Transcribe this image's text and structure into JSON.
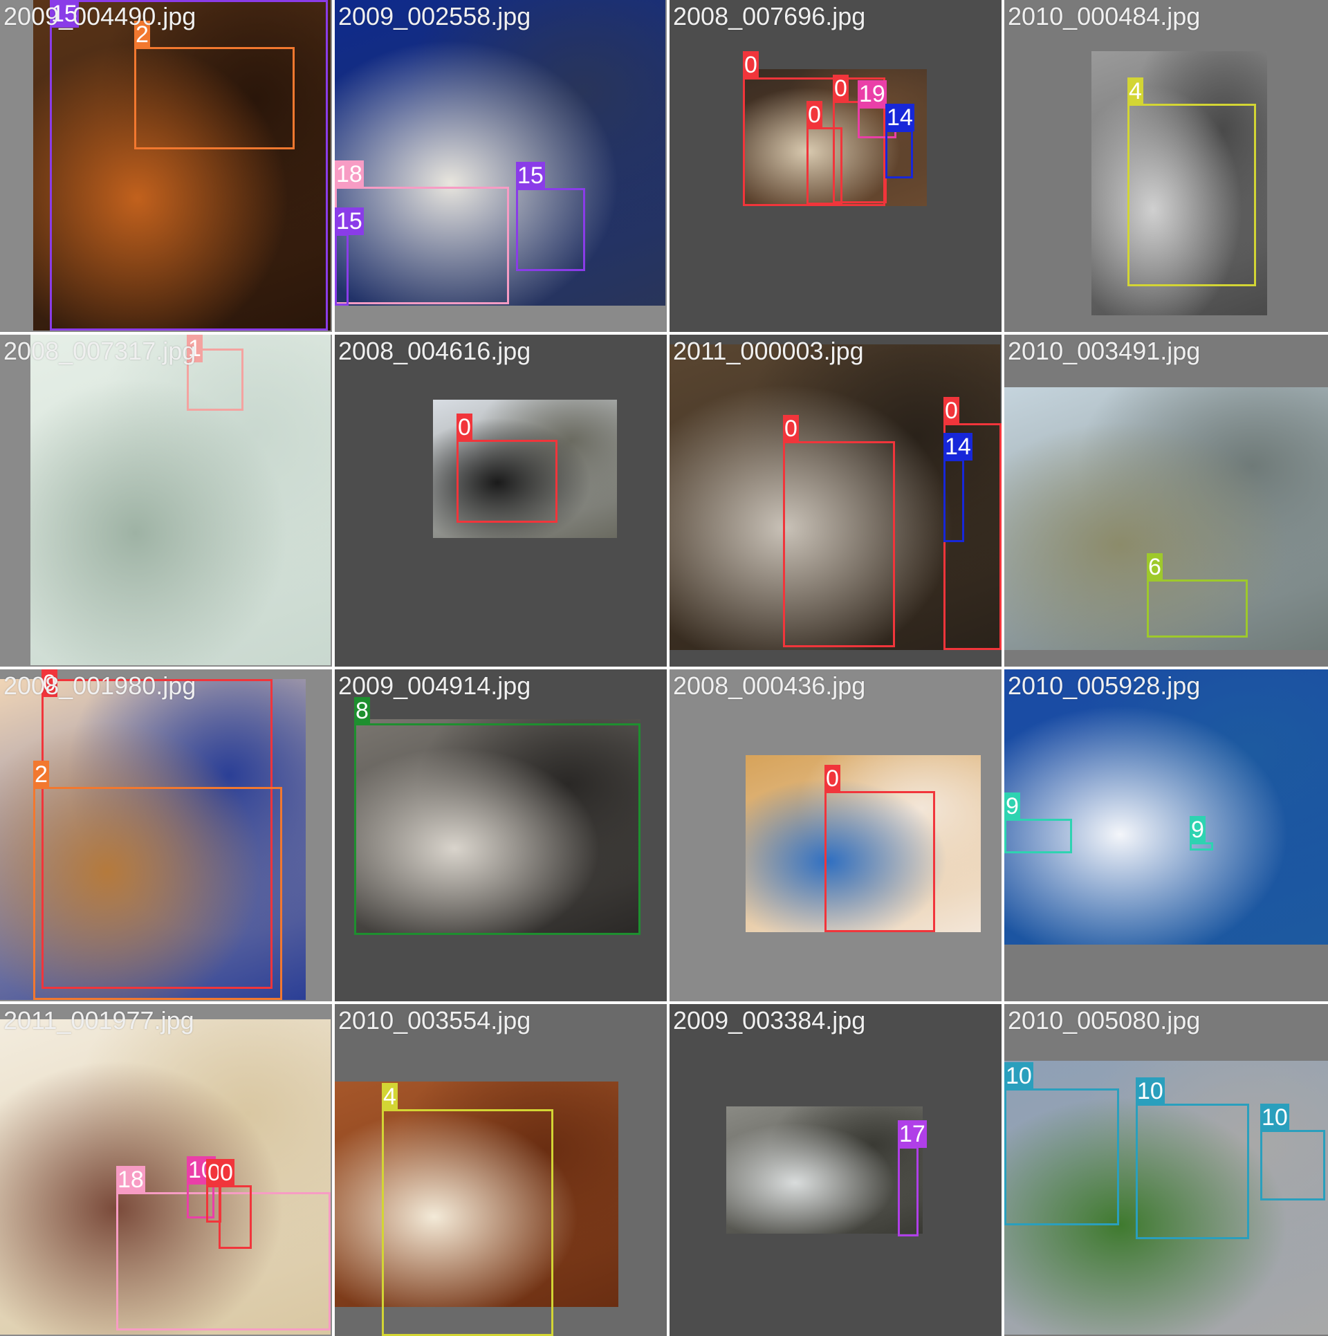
{
  "tiles": [
    {
      "filename": "2009_004490.jpg",
      "bg": "#8a8a8a",
      "photo_colors": [
        "#5a3418",
        "#c2611d",
        "#2a160a"
      ],
      "labels": [
        {
          "class": "15",
          "color": "#8a3ce8"
        },
        {
          "class": "2",
          "color": "#f2782f"
        }
      ]
    },
    {
      "filename": "2009_002558.jpg",
      "bg": "#8a8a8a",
      "photo_colors": [
        "#0e2a8c",
        "#e9e6de",
        "#29355a"
      ],
      "labels": [
        {
          "class": "18",
          "color": "#f79cc4"
        },
        {
          "class": "15",
          "color": "#8a3ce8"
        },
        {
          "class": "15",
          "color": "#8a3ce8"
        }
      ]
    },
    {
      "filename": "2008_007696.jpg",
      "bg": "#4d4d4d",
      "photo_colors": [
        "#3a2c22",
        "#d9cab0",
        "#6a4a30"
      ],
      "labels": [
        {
          "class": "0",
          "color": "#f1353b"
        },
        {
          "class": "0",
          "color": "#f1353b"
        },
        {
          "class": "19",
          "color": "#ea3fa8"
        },
        {
          "class": "0",
          "color": "#f1353b"
        },
        {
          "class": "14",
          "color": "#1727d9"
        }
      ]
    },
    {
      "filename": "2010_000484.jpg",
      "bg": "#7a7a7a",
      "photo_colors": [
        "#9a9a9a",
        "#d0d0d0",
        "#4a4a4a"
      ],
      "labels": [
        {
          "class": "4",
          "color": "#d3d534"
        }
      ]
    },
    {
      "filename": "2008_007317.jpg",
      "bg": "#8a8a8a",
      "photo_colors": [
        "#e6efe7",
        "#9eb2a4",
        "#c9d8cf"
      ],
      "labels": [
        {
          "class": "1",
          "color": "#f4a3a0"
        }
      ]
    },
    {
      "filename": "2008_004616.jpg",
      "bg": "#4d4d4d",
      "photo_colors": [
        "#d8dde3",
        "#1a1a1a",
        "#6a6a60"
      ],
      "labels": [
        {
          "class": "0",
          "color": "#f1353b"
        }
      ]
    },
    {
      "filename": "2011_000003.jpg",
      "bg": "#4d4d4d",
      "photo_colors": [
        "#5a4631",
        "#c9c2b8",
        "#2a221a"
      ],
      "labels": [
        {
          "class": "0",
          "color": "#f1353b"
        },
        {
          "class": "0",
          "color": "#f1353b"
        },
        {
          "class": "14",
          "color": "#1727d9"
        }
      ]
    },
    {
      "filename": "2010_003491.jpg",
      "bg": "#7a7a7a",
      "photo_colors": [
        "#c5d4dd",
        "#8c8b6a",
        "#6f7a78"
      ],
      "labels": [
        {
          "class": "6",
          "color": "#9ec92b"
        }
      ]
    },
    {
      "filename": "2008_001980.jpg",
      "bg": "#8a8a8a",
      "photo_colors": [
        "#f0d5b6",
        "#b57a3c",
        "#2b3f96"
      ],
      "labels": [
        {
          "class": "0",
          "color": "#f1353b"
        },
        {
          "class": "2",
          "color": "#f2782f"
        }
      ]
    },
    {
      "filename": "2009_004914.jpg",
      "bg": "#4d4d4d",
      "photo_colors": [
        "#7a7670",
        "#d9d4cc",
        "#2a2826"
      ],
      "labels": [
        {
          "class": "8",
          "color": "#1e8f2f"
        }
      ]
    },
    {
      "filename": "2008_000436.jpg",
      "bg": "#8a8a8a",
      "photo_colors": [
        "#d7a35a",
        "#2f6fc2",
        "#f3e6d8"
      ],
      "labels": [
        {
          "class": "0",
          "color": "#f1353b"
        }
      ]
    },
    {
      "filename": "2010_005928.jpg",
      "bg": "#7a7a7a",
      "photo_colors": [
        "#1a4aa5",
        "#f4f6fa",
        "#1d5aa0"
      ],
      "labels": [
        {
          "class": "9",
          "color": "#2ed3b1"
        },
        {
          "class": "9",
          "color": "#2ed3b1"
        }
      ]
    },
    {
      "filename": "2011_001977.jpg",
      "bg": "#8a8a8a",
      "photo_colors": [
        "#f3ecde",
        "#7a4a3a",
        "#d9c7a2"
      ],
      "labels": [
        {
          "class": "18",
          "color": "#f79cc4"
        },
        {
          "class": "10",
          "color": "#ea3fa8"
        },
        {
          "class": "0",
          "color": "#f1353b"
        },
        {
          "class": "0",
          "color": "#f1353b"
        }
      ]
    },
    {
      "filename": "2010_003554.jpg",
      "bg": "#6a6a6a",
      "photo_colors": [
        "#a6572a",
        "#f3ead8",
        "#6a2e12"
      ],
      "labels": [
        {
          "class": "4",
          "color": "#d3d534"
        }
      ]
    },
    {
      "filename": "2009_003384.jpg",
      "bg": "#4d4d4d",
      "photo_colors": [
        "#8a8a84",
        "#d9dcdc",
        "#3a3a34"
      ],
      "labels": [
        {
          "class": "17",
          "color": "#b03fe8"
        }
      ]
    },
    {
      "filename": "2010_005080.jpg",
      "bg": "#7a7a7a",
      "photo_colors": [
        "#8ea0b6",
        "#3f7a2e",
        "#a8a8a8"
      ],
      "labels": [
        {
          "class": "10",
          "color": "#2a9fbd"
        },
        {
          "class": "10",
          "color": "#2a9fbd"
        },
        {
          "class": "10",
          "color": "#2a9fbd"
        }
      ]
    }
  ]
}
